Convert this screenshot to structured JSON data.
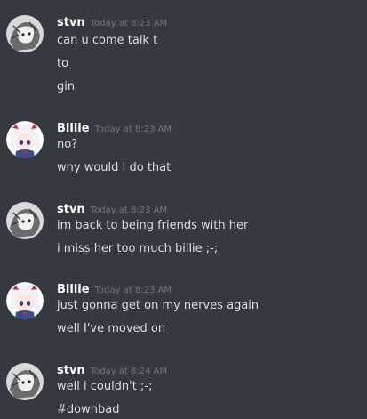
{
  "messages": [
    {
      "username": "stvn",
      "timestamp": "Today at 8:23 AM",
      "avatar_icon": "grey-sketch-avatar-icon",
      "lines": [
        "can u come talk t",
        "to",
        "gin"
      ]
    },
    {
      "username": "Billie",
      "timestamp": "Today at 8:23 AM",
      "avatar_icon": "anime-girl-avatar-icon",
      "lines": [
        "no?",
        "why would I do that"
      ]
    },
    {
      "username": "stvn",
      "timestamp": "Today at 8:23 AM",
      "avatar_icon": "grey-sketch-avatar-icon",
      "lines": [
        "im back to being friends with her",
        "i miss her too much billie ;-;"
      ]
    },
    {
      "username": "Billie",
      "timestamp": "Today at 8:23 AM",
      "avatar_icon": "anime-girl-avatar-icon",
      "lines": [
        "just gonna get on my nerves again",
        "well I've moved on"
      ]
    },
    {
      "username": "stvn",
      "timestamp": "Today at 8:24 AM",
      "avatar_icon": "grey-sketch-avatar-icon",
      "lines": [
        "well i couldn't ;-;",
        "#downbad"
      ]
    }
  ],
  "colors": {
    "background": "#36393f",
    "username": "#ffffff",
    "text": "#dcddde",
    "timestamp": "#72767d"
  }
}
